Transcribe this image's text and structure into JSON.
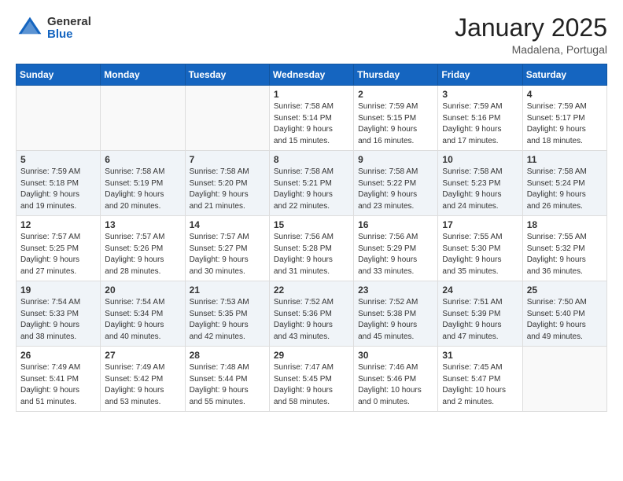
{
  "header": {
    "logo_general": "General",
    "logo_blue": "Blue",
    "month_title": "January 2025",
    "subtitle": "Madalena, Portugal"
  },
  "days_of_week": [
    "Sunday",
    "Monday",
    "Tuesday",
    "Wednesday",
    "Thursday",
    "Friday",
    "Saturday"
  ],
  "weeks": [
    {
      "alt": false,
      "days": [
        {
          "num": "",
          "info": ""
        },
        {
          "num": "",
          "info": ""
        },
        {
          "num": "",
          "info": ""
        },
        {
          "num": "1",
          "info": "Sunrise: 7:58 AM\nSunset: 5:14 PM\nDaylight: 9 hours\nand 15 minutes."
        },
        {
          "num": "2",
          "info": "Sunrise: 7:59 AM\nSunset: 5:15 PM\nDaylight: 9 hours\nand 16 minutes."
        },
        {
          "num": "3",
          "info": "Sunrise: 7:59 AM\nSunset: 5:16 PM\nDaylight: 9 hours\nand 17 minutes."
        },
        {
          "num": "4",
          "info": "Sunrise: 7:59 AM\nSunset: 5:17 PM\nDaylight: 9 hours\nand 18 minutes."
        }
      ]
    },
    {
      "alt": true,
      "days": [
        {
          "num": "5",
          "info": "Sunrise: 7:59 AM\nSunset: 5:18 PM\nDaylight: 9 hours\nand 19 minutes."
        },
        {
          "num": "6",
          "info": "Sunrise: 7:58 AM\nSunset: 5:19 PM\nDaylight: 9 hours\nand 20 minutes."
        },
        {
          "num": "7",
          "info": "Sunrise: 7:58 AM\nSunset: 5:20 PM\nDaylight: 9 hours\nand 21 minutes."
        },
        {
          "num": "8",
          "info": "Sunrise: 7:58 AM\nSunset: 5:21 PM\nDaylight: 9 hours\nand 22 minutes."
        },
        {
          "num": "9",
          "info": "Sunrise: 7:58 AM\nSunset: 5:22 PM\nDaylight: 9 hours\nand 23 minutes."
        },
        {
          "num": "10",
          "info": "Sunrise: 7:58 AM\nSunset: 5:23 PM\nDaylight: 9 hours\nand 24 minutes."
        },
        {
          "num": "11",
          "info": "Sunrise: 7:58 AM\nSunset: 5:24 PM\nDaylight: 9 hours\nand 26 minutes."
        }
      ]
    },
    {
      "alt": false,
      "days": [
        {
          "num": "12",
          "info": "Sunrise: 7:57 AM\nSunset: 5:25 PM\nDaylight: 9 hours\nand 27 minutes."
        },
        {
          "num": "13",
          "info": "Sunrise: 7:57 AM\nSunset: 5:26 PM\nDaylight: 9 hours\nand 28 minutes."
        },
        {
          "num": "14",
          "info": "Sunrise: 7:57 AM\nSunset: 5:27 PM\nDaylight: 9 hours\nand 30 minutes."
        },
        {
          "num": "15",
          "info": "Sunrise: 7:56 AM\nSunset: 5:28 PM\nDaylight: 9 hours\nand 31 minutes."
        },
        {
          "num": "16",
          "info": "Sunrise: 7:56 AM\nSunset: 5:29 PM\nDaylight: 9 hours\nand 33 minutes."
        },
        {
          "num": "17",
          "info": "Sunrise: 7:55 AM\nSunset: 5:30 PM\nDaylight: 9 hours\nand 35 minutes."
        },
        {
          "num": "18",
          "info": "Sunrise: 7:55 AM\nSunset: 5:32 PM\nDaylight: 9 hours\nand 36 minutes."
        }
      ]
    },
    {
      "alt": true,
      "days": [
        {
          "num": "19",
          "info": "Sunrise: 7:54 AM\nSunset: 5:33 PM\nDaylight: 9 hours\nand 38 minutes."
        },
        {
          "num": "20",
          "info": "Sunrise: 7:54 AM\nSunset: 5:34 PM\nDaylight: 9 hours\nand 40 minutes."
        },
        {
          "num": "21",
          "info": "Sunrise: 7:53 AM\nSunset: 5:35 PM\nDaylight: 9 hours\nand 42 minutes."
        },
        {
          "num": "22",
          "info": "Sunrise: 7:52 AM\nSunset: 5:36 PM\nDaylight: 9 hours\nand 43 minutes."
        },
        {
          "num": "23",
          "info": "Sunrise: 7:52 AM\nSunset: 5:38 PM\nDaylight: 9 hours\nand 45 minutes."
        },
        {
          "num": "24",
          "info": "Sunrise: 7:51 AM\nSunset: 5:39 PM\nDaylight: 9 hours\nand 47 minutes."
        },
        {
          "num": "25",
          "info": "Sunrise: 7:50 AM\nSunset: 5:40 PM\nDaylight: 9 hours\nand 49 minutes."
        }
      ]
    },
    {
      "alt": false,
      "days": [
        {
          "num": "26",
          "info": "Sunrise: 7:49 AM\nSunset: 5:41 PM\nDaylight: 9 hours\nand 51 minutes."
        },
        {
          "num": "27",
          "info": "Sunrise: 7:49 AM\nSunset: 5:42 PM\nDaylight: 9 hours\nand 53 minutes."
        },
        {
          "num": "28",
          "info": "Sunrise: 7:48 AM\nSunset: 5:44 PM\nDaylight: 9 hours\nand 55 minutes."
        },
        {
          "num": "29",
          "info": "Sunrise: 7:47 AM\nSunset: 5:45 PM\nDaylight: 9 hours\nand 58 minutes."
        },
        {
          "num": "30",
          "info": "Sunrise: 7:46 AM\nSunset: 5:46 PM\nDaylight: 10 hours\nand 0 minutes."
        },
        {
          "num": "31",
          "info": "Sunrise: 7:45 AM\nSunset: 5:47 PM\nDaylight: 10 hours\nand 2 minutes."
        },
        {
          "num": "",
          "info": ""
        }
      ]
    }
  ]
}
